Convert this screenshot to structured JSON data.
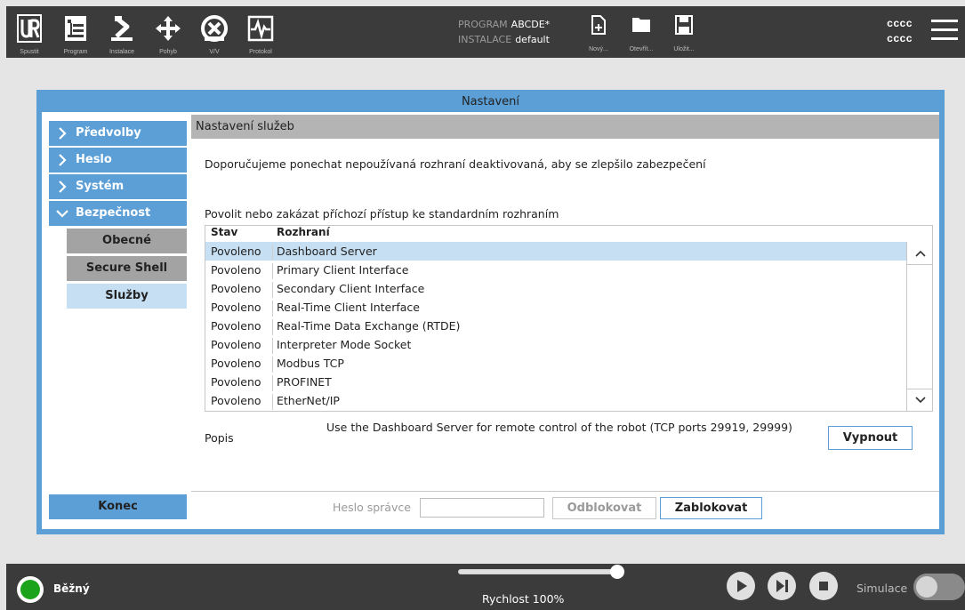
{
  "topbar": {
    "nav": [
      {
        "label": "Spustit",
        "icon": "ur-logo-icon"
      },
      {
        "label": "Program",
        "icon": "program-icon"
      },
      {
        "label": "Instalace",
        "icon": "installation-icon"
      },
      {
        "label": "Pohyb",
        "icon": "move-icon"
      },
      {
        "label": "V/V",
        "icon": "io-icon"
      },
      {
        "label": "Protokol",
        "icon": "log-icon"
      }
    ],
    "program_label": "PROGRAM",
    "program_value": "ABCDE*",
    "installation_label": "INSTALACE",
    "installation_value": "default",
    "file_buttons": [
      {
        "label": "Nový...",
        "icon": "new-file-icon"
      },
      {
        "label": "Otevřít...",
        "icon": "open-folder-icon"
      },
      {
        "label": "Uložit...",
        "icon": "save-icon"
      }
    ],
    "user_line1": "cccc",
    "user_line2": "cccc"
  },
  "dialog": {
    "title": "Nastavení",
    "sidebar": {
      "items": [
        {
          "label": "Předvolby",
          "expanded": false
        },
        {
          "label": "Heslo",
          "expanded": false
        },
        {
          "label": "Systém",
          "expanded": false
        },
        {
          "label": "Bezpečnost",
          "expanded": true
        }
      ],
      "subitems": [
        {
          "label": "Obecné",
          "active": false
        },
        {
          "label": "Secure Shell",
          "active": false
        },
        {
          "label": "Služby",
          "active": true
        }
      ],
      "exit_label": "Konec"
    },
    "main": {
      "header": "Nastavení služeb",
      "recommendation": "Doporučujeme ponechat nepoužívaná rozhraní deaktivovaná, aby se zlepšilo zabezpečení",
      "list_label": "Povolit nebo zakázat příchozí přístup ke standardním rozhraním",
      "columns": [
        "Stav",
        "Rozhraní"
      ],
      "rows": [
        {
          "state": "Povoleno",
          "interface": "Dashboard Server",
          "selected": true
        },
        {
          "state": "Povoleno",
          "interface": "Primary Client Interface",
          "selected": false
        },
        {
          "state": "Povoleno",
          "interface": "Secondary Client Interface",
          "selected": false
        },
        {
          "state": "Povoleno",
          "interface": "Real-Time Client Interface",
          "selected": false
        },
        {
          "state": "Povoleno",
          "interface": "Real-Time Data Exchange (RTDE)",
          "selected": false
        },
        {
          "state": "Povoleno",
          "interface": "Interpreter Mode Socket",
          "selected": false
        },
        {
          "state": "Povoleno",
          "interface": "Modbus TCP",
          "selected": false
        },
        {
          "state": "Povoleno",
          "interface": "PROFINET",
          "selected": false
        },
        {
          "state": "Povoleno",
          "interface": "EtherNet/IP",
          "selected": false
        }
      ],
      "description_label": "Popis",
      "description_text": "Use the Dashboard Server for remote control of the robot (TCP ports 29919, 29999)",
      "disable_button": "Vypnout",
      "admin_password_label": "Heslo správce",
      "admin_password_value": "",
      "unlock_button": "Odblokovat",
      "lock_button": "Zablokovat"
    }
  },
  "bottombar": {
    "status": "Běžný",
    "status_color": "#1ba41b",
    "speed_label": "Rychlost 100%",
    "speed_fraction": 1.0,
    "simulation_label": "Simulace",
    "simulation_on": false
  },
  "colors": {
    "accent": "#5b9fd6",
    "selected": "#c6dff2",
    "bar": "#3b3b3b"
  }
}
